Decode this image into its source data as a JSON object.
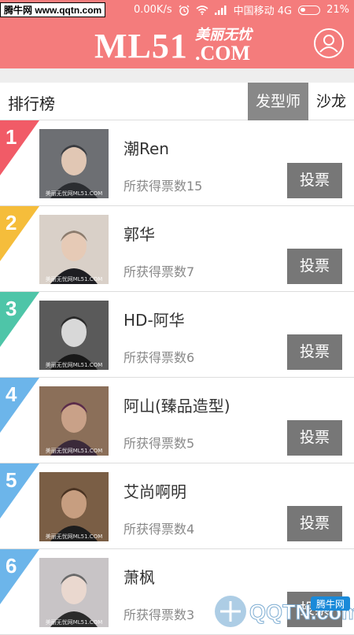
{
  "status_bar": {
    "watermark": "腾牛网 www.qqtn.com",
    "speed": "0.00K/s",
    "carrier": "中国移动 4G",
    "battery": "21%",
    "battery_level": 0.21
  },
  "header": {
    "logo_main": "ML51",
    "logo_cn": "美丽无忧",
    "logo_com": ".COM",
    "profile_icon": "user-profile-icon"
  },
  "rank_bar": {
    "title": "排行榜",
    "tabs": [
      {
        "label": "发型师",
        "active": true
      },
      {
        "label": "沙龙",
        "active": false
      }
    ]
  },
  "vote_label": "投票",
  "avatar_watermark": "美丽无忧网ML51.COM",
  "stylists": [
    {
      "rank": "1",
      "name": "潮Ren",
      "votes": "所获得票数15",
      "color": "#f15b67"
    },
    {
      "rank": "2",
      "name": "郭华",
      "votes": "所获得票数7",
      "color": "#f5bd3b"
    },
    {
      "rank": "3",
      "name": "HD-阿华",
      "votes": "所获得票数6",
      "color": "#4ec5a8"
    },
    {
      "rank": "4",
      "name": "阿山(臻品造型)",
      "votes": "所获得票数5",
      "color": "#6cb5ea"
    },
    {
      "rank": "5",
      "name": "艾尚啊明",
      "votes": "所获得票数4",
      "color": "#6cb5ea"
    },
    {
      "rank": "6",
      "name": "萧枫",
      "votes": "所获得票数3",
      "color": "#6cb5ea"
    }
  ],
  "bottom_watermark": {
    "text": "QQTN.com",
    "badge": "腾牛网"
  }
}
